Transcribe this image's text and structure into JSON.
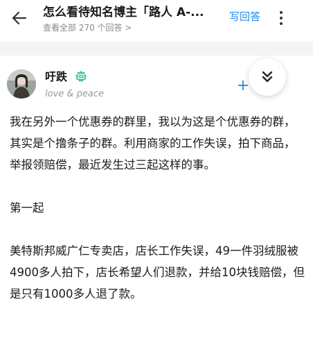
{
  "header": {
    "title": "怎么看待知名博主「路人 A-...",
    "subtitle": "查看全部 270 个回答 >",
    "write_answer": "写回答"
  },
  "author": {
    "name": "吁跌",
    "bio": "love & peace"
  },
  "follow_label": "+",
  "content": {
    "paragraphs": [
      "我在另外一个优惠券的群里，我以为这是个优惠券的群，其实是个撸条子的群。利用商家的工作失误，拍下商品，举报领赔偿，最近发生过三起这样的事。",
      "第一起",
      "美特斯邦威广仁专卖店，店长工作失误，49一件羽绒服被4900多人拍下，店长希望人们退款，并给10块钱赔偿，但是只有1000多人退了款。"
    ]
  },
  "colors": {
    "accent": "#1e8cf0",
    "secondary_text": "#8a8a8a",
    "band": "#f4f4f6"
  },
  "icons": [
    "back-arrow-icon",
    "more-vertical-icon",
    "verified-badge-icon",
    "double-chevron-down-icon"
  ]
}
